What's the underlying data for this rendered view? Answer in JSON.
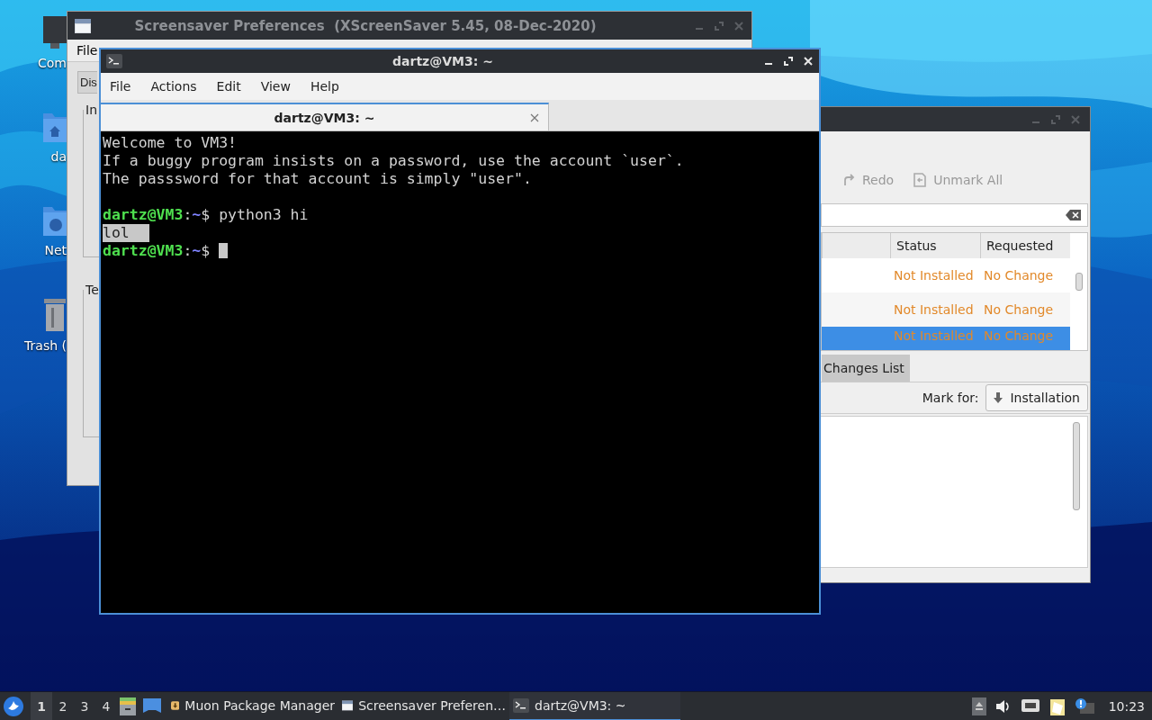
{
  "desktop": {
    "icons": [
      {
        "label": "Com",
        "kind": "computer"
      },
      {
        "label": "da",
        "kind": "home"
      },
      {
        "label": "Net",
        "kind": "network"
      },
      {
        "label": "Trash (",
        "kind": "trash"
      }
    ]
  },
  "screensaver_window": {
    "title": "Screensaver Preferences  (XScreenSaver 5.45, 08-Dec-2020)",
    "menu": [
      "File"
    ],
    "tab": "Dis",
    "groups": [
      "In",
      "Te"
    ]
  },
  "terminal": {
    "title": "dartz@VM3: ~",
    "menu": [
      "File",
      "Actions",
      "Edit",
      "View",
      "Help"
    ],
    "tab": "dartz@VM3: ~",
    "lines": [
      {
        "kind": "text",
        "text": "Welcome to VM3!"
      },
      {
        "kind": "text",
        "text": "If a buggy program insists on a password, use the account `user`."
      },
      {
        "kind": "text",
        "text": "The passsword for that account is simply \"user\"."
      },
      {
        "kind": "blank"
      },
      {
        "kind": "prompt",
        "host": "dartz@VM3",
        "colon": ":",
        "path": "~",
        "symbol": "$",
        "command": "python3 hi"
      },
      {
        "kind": "text",
        "text": "lol",
        "highlighted": true
      },
      {
        "kind": "prompt",
        "host": "dartz@VM3",
        "colon": ":",
        "path": "~",
        "symbol": "$",
        "cursor": true
      }
    ]
  },
  "package_manager": {
    "toolbar": [
      {
        "label": "Redo",
        "kind": "redo",
        "disabled": true
      },
      {
        "label": "Unmark All",
        "kind": "unmark",
        "disabled": true
      }
    ],
    "columns": [
      "Status",
      "Requested"
    ],
    "rows": [
      {
        "status": "Not Installed",
        "requested": "No Change",
        "selected": false
      },
      {
        "status": "Not Installed",
        "requested": "No Change",
        "selected": false
      },
      {
        "status": "Not Installed",
        "requested": "No Change",
        "selected": true
      }
    ],
    "tab": "Changes List",
    "mark_for_label": "Mark for:",
    "mark_for_button": "Installation"
  },
  "taskbar": {
    "workspaces": [
      {
        "label": "1",
        "selected": true
      },
      {
        "label": "2",
        "selected": false
      },
      {
        "label": "3",
        "selected": false
      },
      {
        "label": "4",
        "selected": false
      }
    ],
    "tasks": [
      {
        "label": "Muon Package Manager",
        "kind": "package",
        "selected": false
      },
      {
        "label": "Screensaver Preferen…",
        "kind": "window",
        "selected": false
      },
      {
        "label": "dartz@VM3: ~",
        "kind": "terminal",
        "selected": true
      }
    ],
    "clock": "10:23"
  }
}
